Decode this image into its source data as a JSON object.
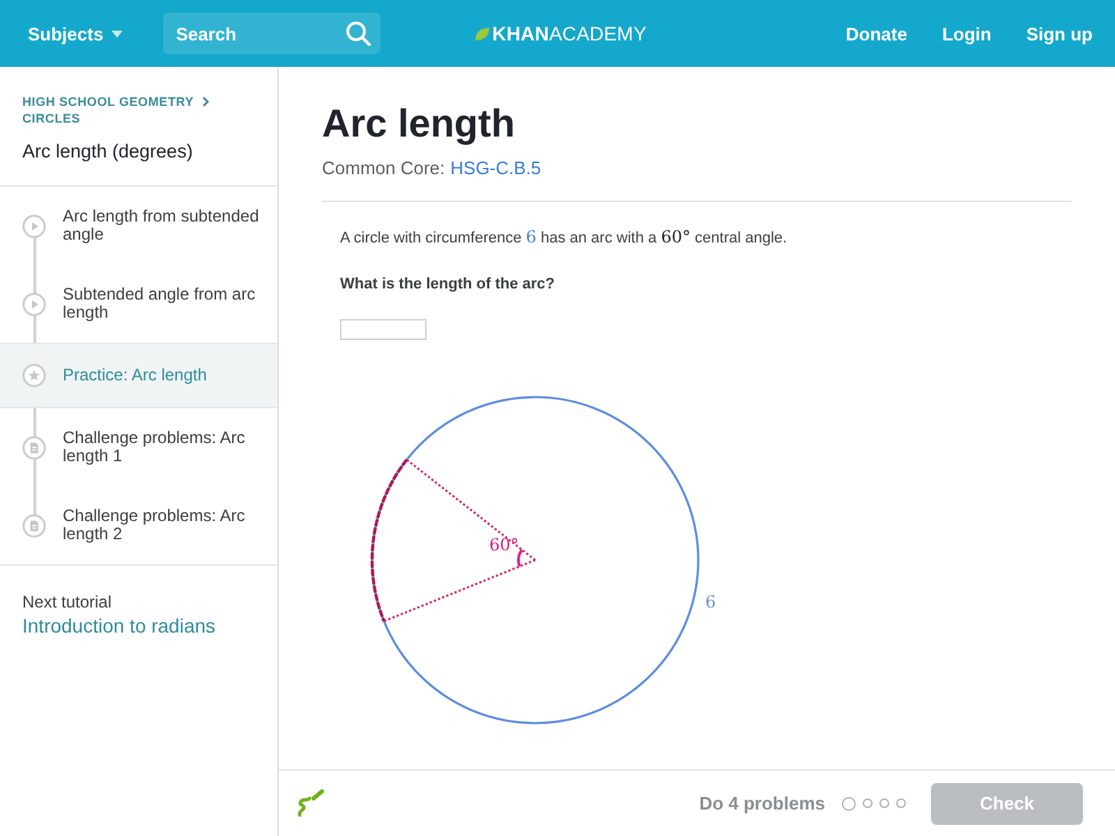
{
  "header": {
    "subjects": "Subjects",
    "search": {
      "placeholder": "Search"
    },
    "logo": "**KHAN**ACADEMY",
    "links": [
      "Donate",
      "Login",
      "Sign up"
    ]
  },
  "sidebar": {
    "breadcrumb": [
      "HIGH SCHOOL GEOMETRY",
      "CIRCLES"
    ],
    "title": "Arc length (degrees)",
    "items": [
      {
        "kind": "video",
        "label": "Arc length from subtended angle",
        "selected": false
      },
      {
        "kind": "video",
        "label": "Subtended angle from arc length",
        "selected": false
      },
      {
        "kind": "exercise",
        "label": "Practice: Arc length",
        "selected": true
      },
      {
        "kind": "article",
        "label": "Challenge problems: Arc length 1",
        "selected": false
      },
      {
        "kind": "article",
        "label": "Challenge problems: Arc length 2",
        "selected": false
      }
    ],
    "next_tutorial": {
      "caption": "Next tutorial",
      "link": "Introduction to radians"
    }
  },
  "exercise": {
    "title": "Arc length",
    "standard": {
      "label": "Common Core:",
      "code": "HSG-C.B.5"
    },
    "statement": [
      {
        "kind": "text",
        "text": "A circle with circumference "
      },
      {
        "kind": "math",
        "text": "6",
        "color": "#4a7fd6"
      },
      {
        "kind": "text",
        "text": " has an arc with a "
      },
      {
        "kind": "math",
        "text": "60°"
      },
      {
        "kind": "text",
        "text": " central angle."
      }
    ],
    "question": "What is the length of the arc?",
    "diagram": {
      "angle_label": "60°",
      "circumference_label": "6"
    }
  },
  "footer": {
    "progress": {
      "label": "Do 4 problems",
      "dots": [
        {
          "selected": true
        },
        {
          "selected": false
        },
        {
          "selected": false
        },
        {
          "selected": false
        }
      ]
    },
    "check_button": {
      "label": "Check",
      "disabled": true
    }
  }
}
